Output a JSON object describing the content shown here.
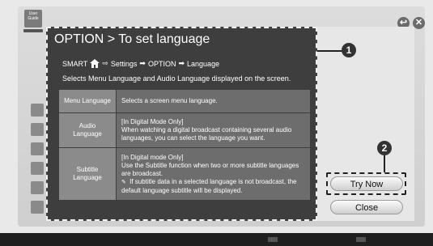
{
  "app": {
    "logo_text": "User Guide"
  },
  "dialog": {
    "title": "OPTION > To set language",
    "path": {
      "start": "SMART",
      "step1": "Settings",
      "step2": "OPTION",
      "step3": "Language"
    },
    "description": "Selects Menu Language and Audio Language displayed on the screen.",
    "rows": [
      {
        "name": "Menu Language",
        "value": "Selects a screen menu language."
      },
      {
        "name": "Audio Language",
        "value_line1": "[In Digital Mode Only]",
        "value_line2": "When watching a digital broadcast containing several audio languages, you can select the language you want."
      },
      {
        "name": "Subtitle Language",
        "value_line1": "[In Digital mode Only]",
        "value_line2": "Use the Subtitle function when two or more subtitle languages are broadcast.",
        "value_note": "If subtitle data in a selected language is not broadcast, the default language subtitle will be displayed."
      }
    ]
  },
  "callouts": {
    "one": "1",
    "two": "2"
  },
  "buttons": {
    "try_now": "Try Now",
    "close": "Close"
  },
  "icons": {
    "back": "↩",
    "exit": "✕",
    "note": "✎"
  },
  "colors": {
    "panel": "#3e3e3e",
    "row_name": "#8b8b8b",
    "row_value": "#6d6d6d"
  }
}
